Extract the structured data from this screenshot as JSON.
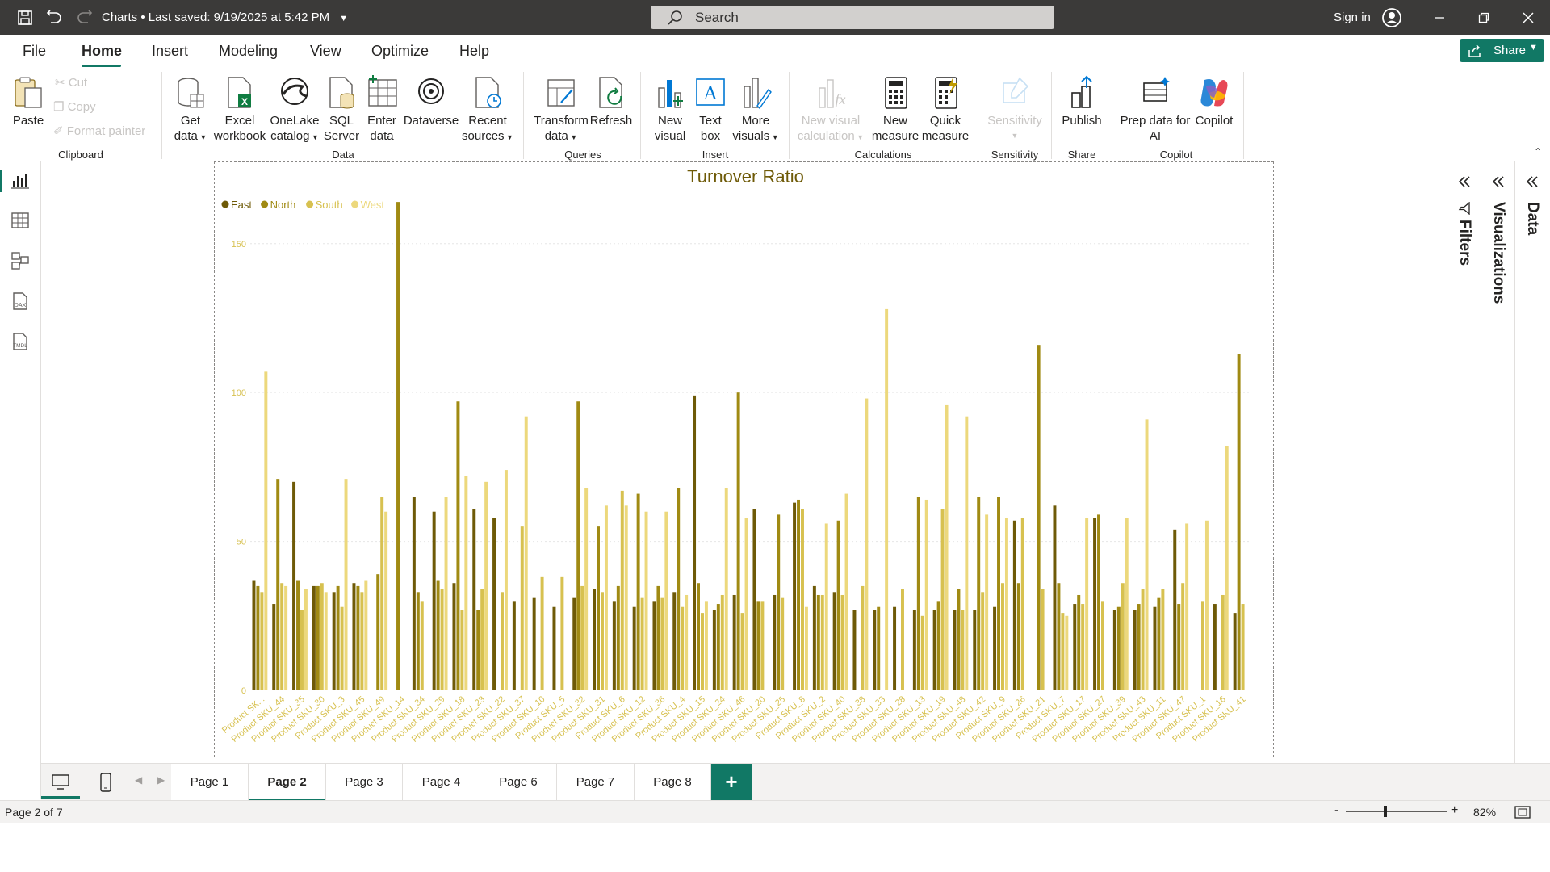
{
  "titlebar": {
    "doc_title": "Charts • Last saved: 9/19/2025 at 5:42 PM",
    "search_placeholder": "Search",
    "sign_in": "Sign in"
  },
  "menu": {
    "tabs": [
      "File",
      "Home",
      "Insert",
      "Modeling",
      "View",
      "Optimize",
      "Help"
    ],
    "active": "Home",
    "share_label": "Share"
  },
  "ribbon": {
    "clipboard": {
      "paste": "Paste",
      "cut": "Cut",
      "copy": "Copy",
      "format_painter": "Format painter",
      "group": "Clipboard"
    },
    "data": {
      "get_data": [
        "Get",
        "data"
      ],
      "excel": [
        "Excel",
        "workbook"
      ],
      "onelake": [
        "OneLake",
        "catalog"
      ],
      "sql": [
        "SQL",
        "Server"
      ],
      "enter": [
        "Enter",
        "data"
      ],
      "dataverse": [
        "Dataverse"
      ],
      "recent": [
        "Recent",
        "sources"
      ],
      "group": "Data"
    },
    "queries": {
      "transform": [
        "Transform",
        "data"
      ],
      "refresh": [
        "Refresh"
      ],
      "group": "Queries"
    },
    "insert": {
      "new_visual": [
        "New",
        "visual"
      ],
      "text_box": [
        "Text",
        "box"
      ],
      "more_visuals": [
        "More",
        "visuals"
      ],
      "group": "Insert"
    },
    "calculations": {
      "new_visual_calc": [
        "New visual",
        "calculation"
      ],
      "new_measure": [
        "New",
        "measure"
      ],
      "quick_measure": [
        "Quick",
        "measure"
      ],
      "group": "Calculations"
    },
    "sensitivity": {
      "label": [
        "Sensitivity"
      ],
      "group": "Sensitivity"
    },
    "share": {
      "publish": [
        "Publish"
      ],
      "group": "Share"
    },
    "copilot": {
      "prep": [
        "Prep data for",
        "AI"
      ],
      "copilot": [
        "Copilot"
      ],
      "group": "Copilot"
    }
  },
  "panes": {
    "filters": "Filters",
    "visualizations": "Visualizations",
    "data": "Data"
  },
  "pages": {
    "tabs": [
      "Page 1",
      "Page 2",
      "Page 3",
      "Page 4",
      "Page 6",
      "Page 7",
      "Page 8"
    ],
    "active": "Page 2",
    "add": "+"
  },
  "status": {
    "page_status": "Page 2 of 7",
    "zoom": "82%"
  },
  "colors": {
    "accent": "#117865",
    "east": "#6e5a07",
    "north": "#a08a13",
    "south": "#d7c150",
    "west": "#ecd87c"
  },
  "chart_data": {
    "type": "bar",
    "title": "Turnover Ratio",
    "legend_position": "top-left",
    "ylim": [
      0,
      170
    ],
    "y_ticks": [
      0,
      50,
      100,
      150
    ],
    "grid": true,
    "categories": [
      "Product SK...",
      "Product SKU_44",
      "Product SKU_35",
      "Product SKU_30",
      "Product SKU_3",
      "Product SKU_45",
      "Product SKU_49",
      "Product SKU_14",
      "Product SKU_34",
      "Product SKU_29",
      "Product SKU_18",
      "Product SKU_23",
      "Product SKU_22",
      "Product SKU_37",
      "Product SKU_10",
      "Product SKU_5",
      "Product SKU_32",
      "Product SKU_31",
      "Product SKU_6",
      "Product SKU_12",
      "Product SKU_36",
      "Product SKU_4",
      "Product SKU_15",
      "Product SKU_24",
      "Product SKU_46",
      "Product SKU_20",
      "Product SKU_25",
      "Product SKU_8",
      "Product SKU_2",
      "Product SKU_40",
      "Product SKU_38",
      "Product SKU_33",
      "Product SKU_28",
      "Product SKU_13",
      "Product SKU_19",
      "Product SKU_48",
      "Product SKU_42",
      "Product SKU_9",
      "Product SKU_26",
      "Product SKU_21",
      "Product SKU_7",
      "Product SKU_17",
      "Product SKU_27",
      "Product SKU_39",
      "Product SKU_43",
      "Product SKU_11",
      "Product SKU_47",
      "Product SKU_1",
      "Product SKU_16",
      "Product SKU_41"
    ],
    "series": [
      {
        "name": "East",
        "values": [
          37,
          29,
          70,
          35,
          33,
          36,
          0,
          0,
          65,
          60,
          36,
          61,
          58,
          30,
          31,
          28,
          31,
          34,
          30,
          28,
          30,
          33,
          99,
          27,
          32,
          61,
          32,
          63,
          35,
          33,
          27,
          27,
          28,
          27,
          27,
          27,
          27,
          28,
          57,
          0,
          62,
          29,
          58,
          27,
          27,
          28,
          54,
          0,
          29,
          26
        ]
      },
      {
        "name": "North",
        "values": [
          35,
          71,
          37,
          35,
          35,
          35,
          39,
          164,
          33,
          37,
          97,
          27,
          0,
          0,
          0,
          0,
          97,
          55,
          35,
          66,
          35,
          68,
          36,
          29,
          100,
          30,
          59,
          64,
          32,
          57,
          0,
          28,
          0,
          65,
          30,
          34,
          65,
          65,
          36,
          116,
          36,
          32,
          59,
          28,
          29,
          31,
          29,
          0,
          0,
          113
        ]
      },
      {
        "name": "South",
        "values": [
          33,
          36,
          27,
          36,
          28,
          33,
          65,
          0,
          30,
          34,
          27,
          34,
          33,
          55,
          38,
          38,
          35,
          33,
          67,
          31,
          31,
          28,
          26,
          32,
          26,
          30,
          31,
          61,
          32,
          32,
          35,
          0,
          34,
          25,
          61,
          27,
          33,
          36,
          58,
          34,
          26,
          29,
          30,
          36,
          34,
          34,
          36,
          30,
          32,
          29
        ]
      },
      {
        "name": "West",
        "values": [
          107,
          35,
          34,
          33,
          71,
          37,
          60,
          0,
          0,
          65,
          72,
          70,
          74,
          92,
          0,
          0,
          68,
          62,
          62,
          60,
          60,
          32,
          30,
          68,
          58,
          0,
          0,
          28,
          56,
          66,
          98,
          128,
          0,
          64,
          96,
          92,
          59,
          58,
          0,
          0,
          25,
          58,
          0,
          58,
          91,
          0,
          56,
          57,
          82,
          0
        ]
      }
    ]
  }
}
